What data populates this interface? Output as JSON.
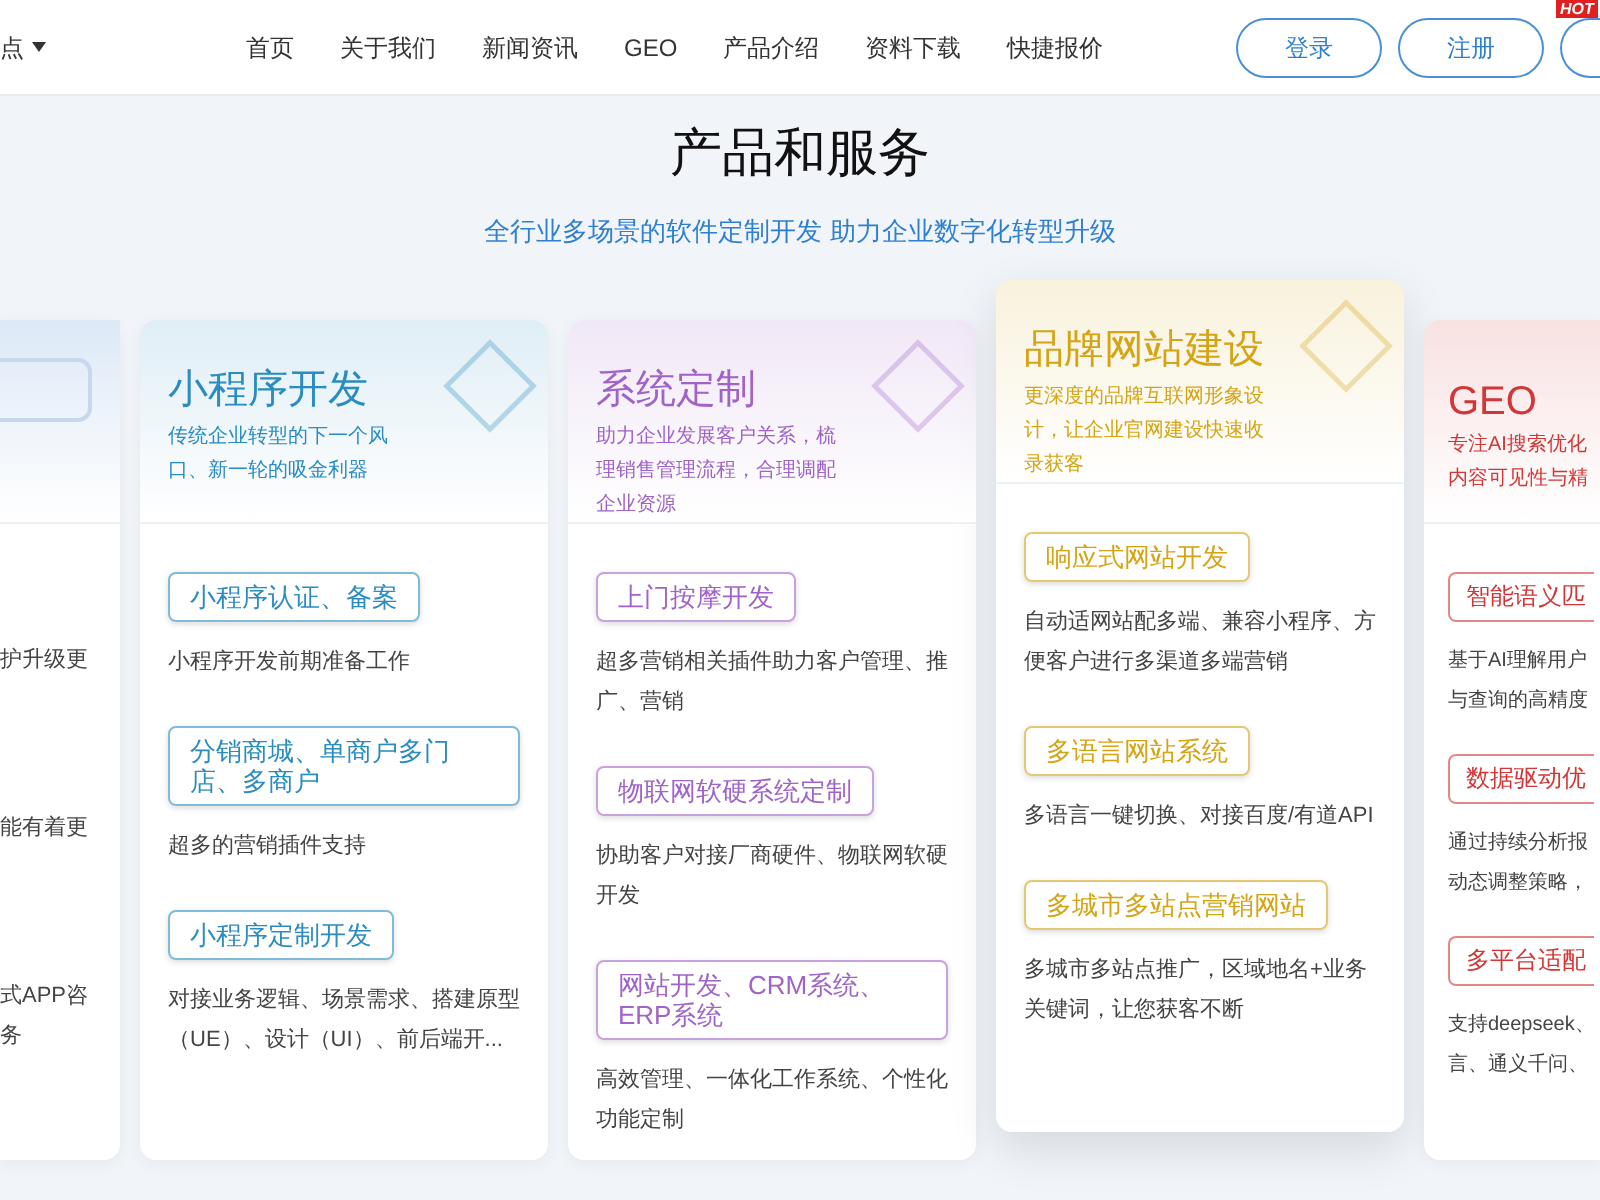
{
  "header": {
    "site_switch": "点",
    "site_switch_expanded": false,
    "nav": [
      {
        "label": "首页"
      },
      {
        "label": "关于我们"
      },
      {
        "label": "新闻资讯"
      },
      {
        "label": "GEO"
      },
      {
        "label": "产品介绍"
      },
      {
        "label": "资料下载"
      },
      {
        "label": "快捷报价"
      }
    ],
    "buttons": [
      {
        "label": "登录"
      },
      {
        "label": "注册"
      }
    ],
    "hot_badge": "HOT"
  },
  "section": {
    "title": "产品和服务",
    "subtitle": "全行业多场景的软件定制开发 助力企业数字化转型升级"
  },
  "cards": [
    {
      "kind": "partial-left",
      "items": [
        {
          "desc_lines": [
            "护升级更"
          ]
        },
        {
          "desc_lines": [
            "能有着更"
          ]
        },
        {
          "desc_lines": [
            "式APP咨",
            "务"
          ]
        }
      ]
    },
    {
      "kind": "full",
      "featured": false,
      "title": "小程序开发",
      "subtitle": "传统企业转型的下一个风口、新一轮的吸金利器",
      "color": "#2a8cc0",
      "items": [
        {
          "tag": "小程序认证、备案",
          "desc": "小程序开发前期准备工作"
        },
        {
          "tag": "分销商城、单商户多门店、多商户",
          "desc": "超多的营销插件支持"
        },
        {
          "tag": "小程序定制开发",
          "desc": "对接业务逻辑、场景需求、搭建原型（UE）、设计（UI）、前后端开..."
        }
      ]
    },
    {
      "kind": "full",
      "featured": false,
      "title": "系统定制",
      "subtitle": "助力企业发展客户关系，梳理销售管理流程，合理调配企业资源",
      "color": "#a064c8",
      "items": [
        {
          "tag": "上门按摩开发",
          "desc": "超多营销相关插件助力客户管理、推广、营销"
        },
        {
          "tag": "物联网软硬系统定制",
          "desc": "协助客户对接厂商硬件、物联网软硬开发"
        },
        {
          "tag": "网站开发、CRM系统、ERP系统",
          "desc": "高效管理、一体化工作系统、个性化功能定制"
        }
      ]
    },
    {
      "kind": "full",
      "featured": true,
      "title": "品牌网站建设",
      "subtitle": "更深度的品牌互联网形象设计，让企业官网建设快速收录获客",
      "color": "#d4a414",
      "items": [
        {
          "tag": "响应式网站开发",
          "desc": "自动适网站配多端、兼容小程序、方便客户进行多渠道多端营销"
        },
        {
          "tag": "多语言网站系统",
          "desc": "多语言一键切换、对接百度/有道API"
        },
        {
          "tag": "多城市多站点营销网站",
          "desc": "多城市多站点推广，区域地名+业务关键词，让您获客不断"
        }
      ]
    },
    {
      "kind": "partial-right",
      "title": "GEO",
      "subtitle_lines": [
        "专注AI搜索优化",
        "内容可见性与精"
      ],
      "color": "#d23636",
      "items": [
        {
          "tag": "智能语义匹",
          "desc_lines": [
            "基于AI理解用户",
            "与查询的高精度"
          ]
        },
        {
          "tag": "数据驱动优",
          "desc_lines": [
            "通过持续分析报",
            "动态调整策略，"
          ]
        },
        {
          "tag": "多平台适配",
          "desc_lines": [
            "支持deepseek、",
            "言、通义千问、"
          ]
        }
      ]
    }
  ]
}
